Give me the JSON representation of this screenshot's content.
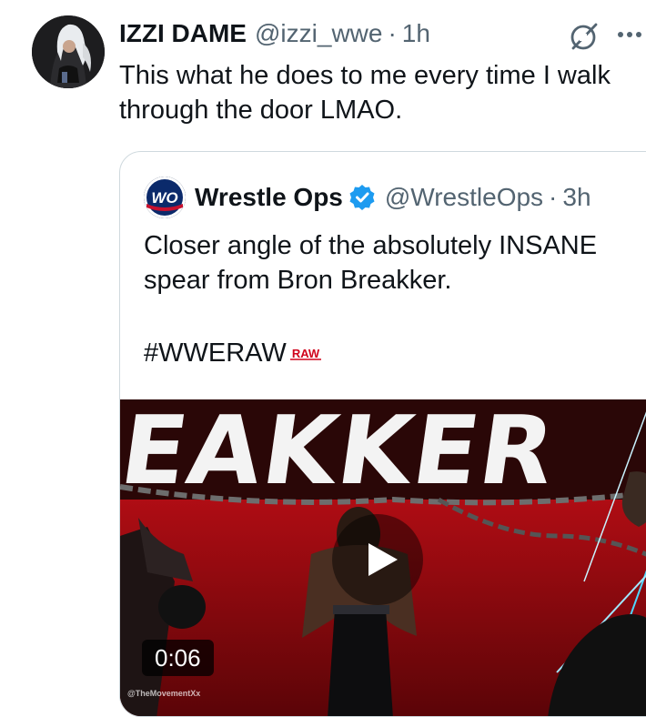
{
  "tweet": {
    "author_name": "IZZI DAME",
    "author_handle": "@izzi_wwe",
    "separator": "·",
    "time": "1h",
    "text_line1": "This what he does to me every time I walk",
    "text_line2": "through the door LMAO.",
    "icons": {
      "grok": "grok-icon",
      "more": "more-icon",
      "avatar": "avatar"
    }
  },
  "quote": {
    "author_name": "Wrestle Ops",
    "author_handle": "@WrestleOps",
    "separator": "·",
    "time": "3h",
    "avatar_text": "WO",
    "text_line1": "Closer angle of the absolutely INSANE",
    "text_line2": "spear from Bron Breakker.",
    "hashtag": "#WWERAW",
    "raw_badge": "RAW",
    "verified_color": "#1d9bf0",
    "video": {
      "banner_text": "EAKKER",
      "duration": "0:06",
      "watermark": "@TheMovementXx",
      "play_icon": "play-icon"
    }
  }
}
